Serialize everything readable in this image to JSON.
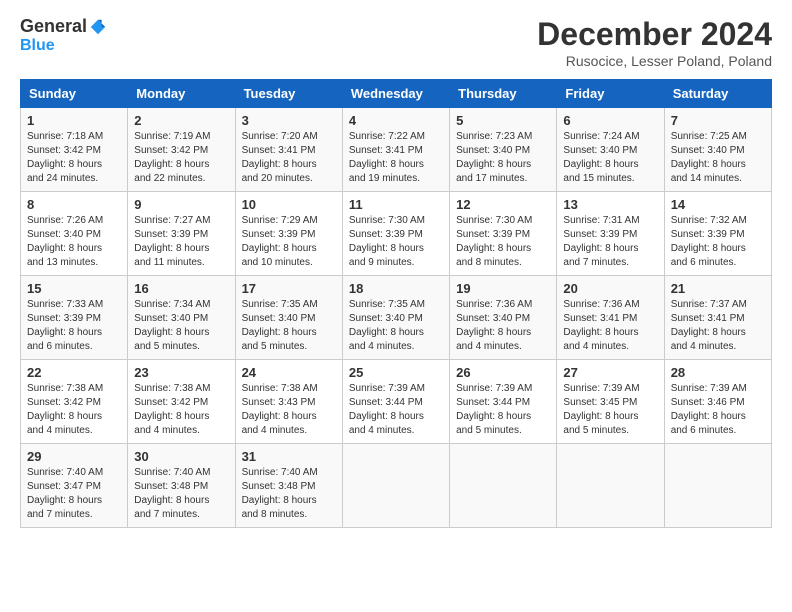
{
  "header": {
    "logo_general": "General",
    "logo_blue": "Blue",
    "month_title": "December 2024",
    "location": "Rusocice, Lesser Poland, Poland"
  },
  "days_of_week": [
    "Sunday",
    "Monday",
    "Tuesday",
    "Wednesday",
    "Thursday",
    "Friday",
    "Saturday"
  ],
  "weeks": [
    [
      {
        "day": "1",
        "info": "Sunrise: 7:18 AM\nSunset: 3:42 PM\nDaylight: 8 hours\nand 24 minutes."
      },
      {
        "day": "2",
        "info": "Sunrise: 7:19 AM\nSunset: 3:42 PM\nDaylight: 8 hours\nand 22 minutes."
      },
      {
        "day": "3",
        "info": "Sunrise: 7:20 AM\nSunset: 3:41 PM\nDaylight: 8 hours\nand 20 minutes."
      },
      {
        "day": "4",
        "info": "Sunrise: 7:22 AM\nSunset: 3:41 PM\nDaylight: 8 hours\nand 19 minutes."
      },
      {
        "day": "5",
        "info": "Sunrise: 7:23 AM\nSunset: 3:40 PM\nDaylight: 8 hours\nand 17 minutes."
      },
      {
        "day": "6",
        "info": "Sunrise: 7:24 AM\nSunset: 3:40 PM\nDaylight: 8 hours\nand 15 minutes."
      },
      {
        "day": "7",
        "info": "Sunrise: 7:25 AM\nSunset: 3:40 PM\nDaylight: 8 hours\nand 14 minutes."
      }
    ],
    [
      {
        "day": "8",
        "info": "Sunrise: 7:26 AM\nSunset: 3:40 PM\nDaylight: 8 hours\nand 13 minutes."
      },
      {
        "day": "9",
        "info": "Sunrise: 7:27 AM\nSunset: 3:39 PM\nDaylight: 8 hours\nand 11 minutes."
      },
      {
        "day": "10",
        "info": "Sunrise: 7:29 AM\nSunset: 3:39 PM\nDaylight: 8 hours\nand 10 minutes."
      },
      {
        "day": "11",
        "info": "Sunrise: 7:30 AM\nSunset: 3:39 PM\nDaylight: 8 hours\nand 9 minutes."
      },
      {
        "day": "12",
        "info": "Sunrise: 7:30 AM\nSunset: 3:39 PM\nDaylight: 8 hours\nand 8 minutes."
      },
      {
        "day": "13",
        "info": "Sunrise: 7:31 AM\nSunset: 3:39 PM\nDaylight: 8 hours\nand 7 minutes."
      },
      {
        "day": "14",
        "info": "Sunrise: 7:32 AM\nSunset: 3:39 PM\nDaylight: 8 hours\nand 6 minutes."
      }
    ],
    [
      {
        "day": "15",
        "info": "Sunrise: 7:33 AM\nSunset: 3:39 PM\nDaylight: 8 hours\nand 6 minutes."
      },
      {
        "day": "16",
        "info": "Sunrise: 7:34 AM\nSunset: 3:40 PM\nDaylight: 8 hours\nand 5 minutes."
      },
      {
        "day": "17",
        "info": "Sunrise: 7:35 AM\nSunset: 3:40 PM\nDaylight: 8 hours\nand 5 minutes."
      },
      {
        "day": "18",
        "info": "Sunrise: 7:35 AM\nSunset: 3:40 PM\nDaylight: 8 hours\nand 4 minutes."
      },
      {
        "day": "19",
        "info": "Sunrise: 7:36 AM\nSunset: 3:40 PM\nDaylight: 8 hours\nand 4 minutes."
      },
      {
        "day": "20",
        "info": "Sunrise: 7:36 AM\nSunset: 3:41 PM\nDaylight: 8 hours\nand 4 minutes."
      },
      {
        "day": "21",
        "info": "Sunrise: 7:37 AM\nSunset: 3:41 PM\nDaylight: 8 hours\nand 4 minutes."
      }
    ],
    [
      {
        "day": "22",
        "info": "Sunrise: 7:38 AM\nSunset: 3:42 PM\nDaylight: 8 hours\nand 4 minutes."
      },
      {
        "day": "23",
        "info": "Sunrise: 7:38 AM\nSunset: 3:42 PM\nDaylight: 8 hours\nand 4 minutes."
      },
      {
        "day": "24",
        "info": "Sunrise: 7:38 AM\nSunset: 3:43 PM\nDaylight: 8 hours\nand 4 minutes."
      },
      {
        "day": "25",
        "info": "Sunrise: 7:39 AM\nSunset: 3:44 PM\nDaylight: 8 hours\nand 4 minutes."
      },
      {
        "day": "26",
        "info": "Sunrise: 7:39 AM\nSunset: 3:44 PM\nDaylight: 8 hours\nand 5 minutes."
      },
      {
        "day": "27",
        "info": "Sunrise: 7:39 AM\nSunset: 3:45 PM\nDaylight: 8 hours\nand 5 minutes."
      },
      {
        "day": "28",
        "info": "Sunrise: 7:39 AM\nSunset: 3:46 PM\nDaylight: 8 hours\nand 6 minutes."
      }
    ],
    [
      {
        "day": "29",
        "info": "Sunrise: 7:40 AM\nSunset: 3:47 PM\nDaylight: 8 hours\nand 7 minutes."
      },
      {
        "day": "30",
        "info": "Sunrise: 7:40 AM\nSunset: 3:48 PM\nDaylight: 8 hours\nand 7 minutes."
      },
      {
        "day": "31",
        "info": "Sunrise: 7:40 AM\nSunset: 3:48 PM\nDaylight: 8 hours\nand 8 minutes."
      },
      {
        "day": "",
        "info": ""
      },
      {
        "day": "",
        "info": ""
      },
      {
        "day": "",
        "info": ""
      },
      {
        "day": "",
        "info": ""
      }
    ]
  ]
}
